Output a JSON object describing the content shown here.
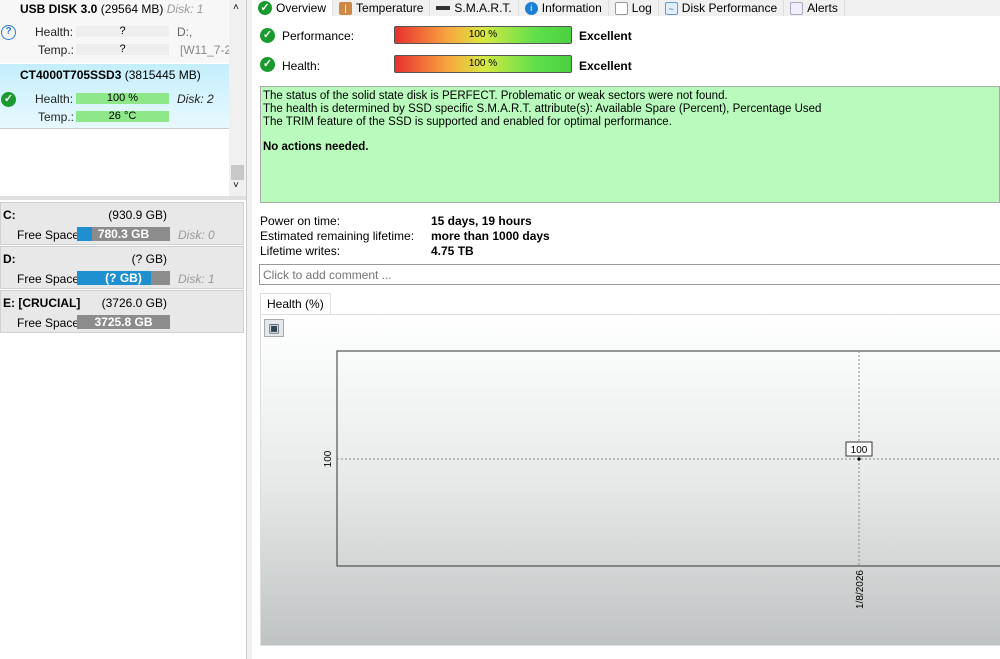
{
  "disks": [
    {
      "name": "USB DISK 3.0",
      "size": "(29564 MB)",
      "disk": "Disk: 1",
      "health_label": "Health:",
      "health": "?",
      "temp_label": "Temp.:",
      "temp": "?",
      "drive": "D:,",
      "volume": "[W11_7-2",
      "status_icon": "question-icon"
    },
    {
      "name": "CT4000T705SSD3",
      "size": "(3815445 MB)",
      "disk": "Disk: 2",
      "health_label": "Health:",
      "health": "100 %",
      "temp_label": "Temp.:",
      "temp": "26 °C",
      "status_icon": "check-icon"
    }
  ],
  "volumes": [
    {
      "name": "C:",
      "size": "(930.9 GB)",
      "free_label": "Free Space",
      "free": "780.3 GB",
      "disk": "Disk: 0",
      "used_pct": 16
    },
    {
      "name": "D:",
      "size": "(? GB)",
      "free_label": "Free Space",
      "free": "(? GB)",
      "disk": "Disk: 1",
      "used_pct": 80
    },
    {
      "name": "E: [CRUCIAL]",
      "size": "(3726.0 GB)",
      "free_label": "Free Space",
      "free": "3725.8 GB",
      "disk": "",
      "used_pct": 0
    }
  ],
  "tabs": [
    "Overview",
    "Temperature",
    "S.M.A.R.T.",
    "Information",
    "Log",
    "Disk Performance",
    "Alerts"
  ],
  "overview": {
    "performance_label": "Performance:",
    "performance_value": "100 %",
    "performance_rating": "Excellent",
    "health_label": "Health:",
    "health_value": "100 %",
    "health_rating": "Excellent",
    "messages": [
      "The status of the solid state disk is PERFECT. Problematic or weak sectors were not found.",
      "The health is determined by SSD specific S.M.A.R.T. attribute(s):  Available Spare (Percent), Percentage Used",
      "The TRIM feature of the SSD is supported and enabled for optimal performance."
    ],
    "action": "No actions needed.",
    "stats": [
      {
        "label": "Power on time:",
        "value": "15 days, 19 hours"
      },
      {
        "label": "Estimated remaining lifetime:",
        "value": "more than 1000 days"
      },
      {
        "label": "Lifetime writes:",
        "value": "4.75 TB"
      }
    ],
    "comment_placeholder": "Click to add comment ..."
  },
  "chart_tab": "Health (%)",
  "chart_data": {
    "type": "line",
    "series": [
      {
        "name": "Health (%)",
        "x": [
          "1/8/2026"
        ],
        "y": [
          100
        ]
      }
    ],
    "y_ticks": [
      "100"
    ],
    "x_ticks": [
      "1/8/2026"
    ],
    "data_labels": [
      "100"
    ]
  }
}
